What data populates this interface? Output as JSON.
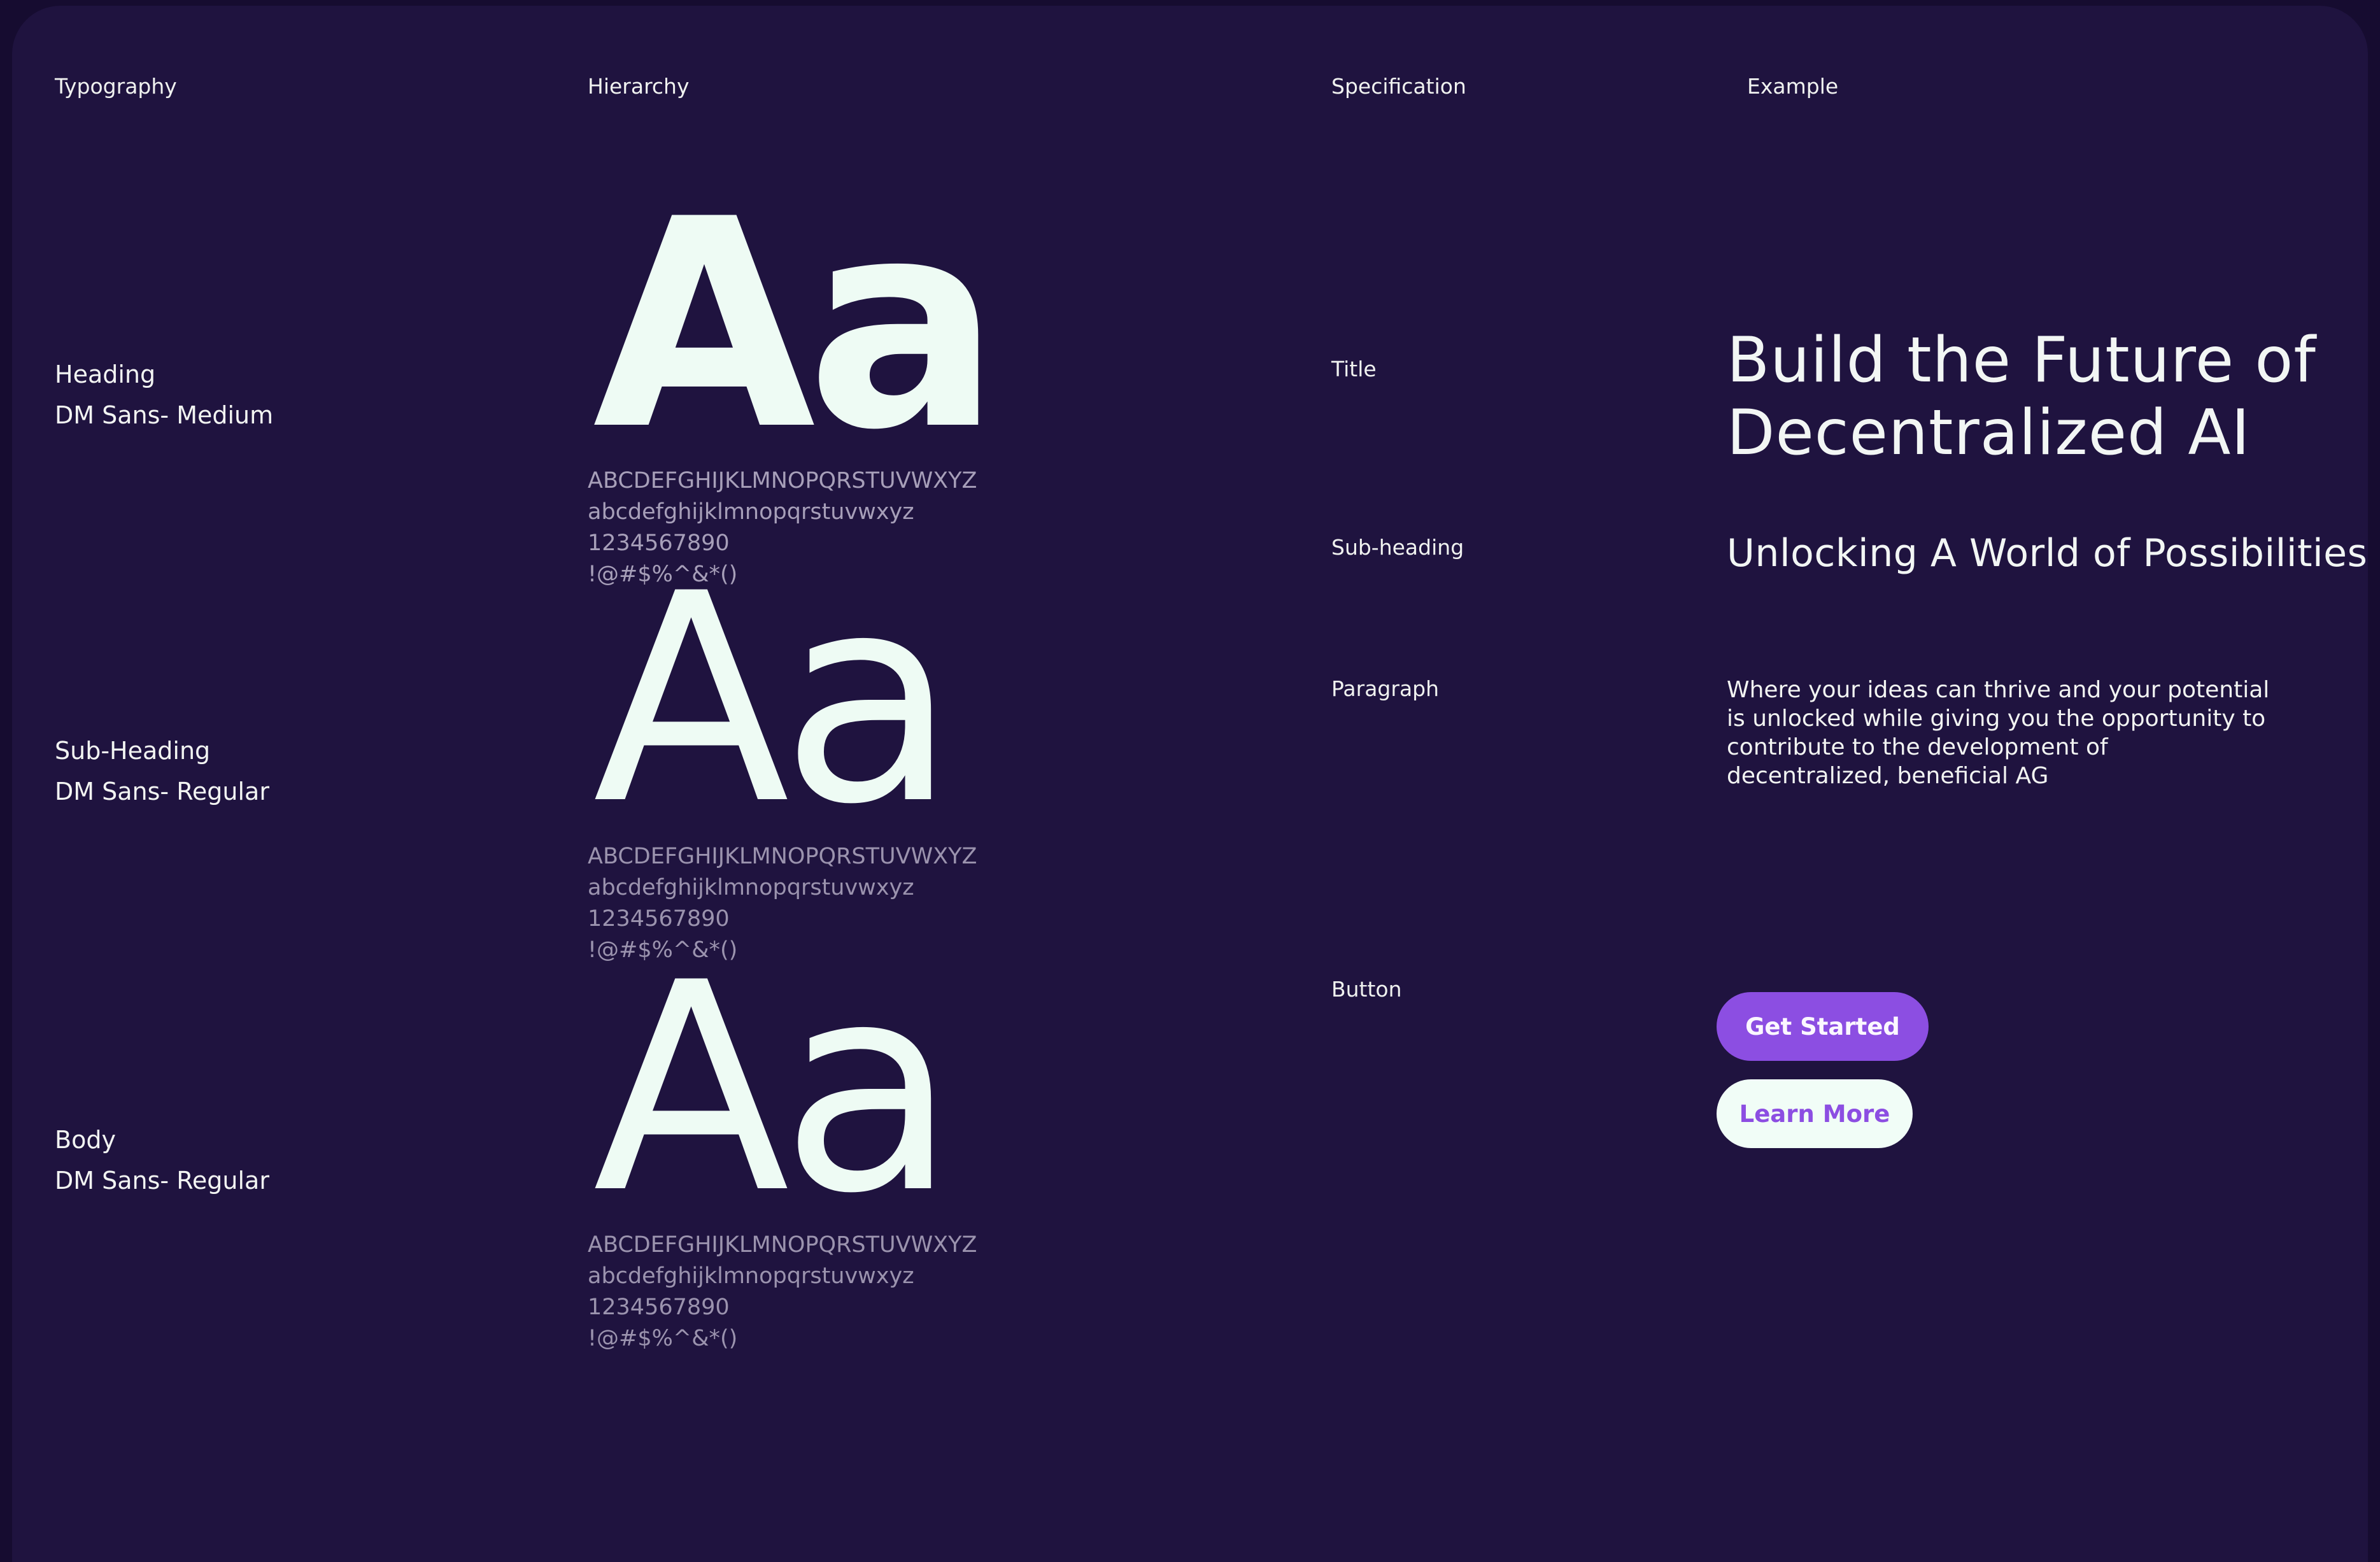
{
  "headers": {
    "typography": "Typography",
    "hierarchy": "Hierarchy",
    "specification": "Specification",
    "example": "Example"
  },
  "styles": [
    {
      "name": "Heading",
      "font": "DM Sans- Medium",
      "sample": "Aa",
      "uppercase": "ABCDEFGHIJKLMNOPQRSTUVWXYZ",
      "lowercase": "abcdefghijklmnopqrstuvwxyz",
      "digits": "1234567890",
      "symbols": "!@#$%^&*()"
    },
    {
      "name": "Sub-Heading",
      "font": "DM Sans- Regular",
      "sample": "Aa",
      "uppercase": "ABCDEFGHIJKLMNOPQRSTUVWXYZ",
      "lowercase": "abcdefghijklmnopqrstuvwxyz",
      "digits": "1234567890",
      "symbols": "!@#$%^&*()"
    },
    {
      "name": "Body",
      "font": "DM Sans- Regular",
      "sample": "Aa",
      "uppercase": "ABCDEFGHIJKLMNOPQRSTUVWXYZ",
      "lowercase": "abcdefghijklmnopqrstuvwxyz",
      "digits": "1234567890",
      "symbols": "!@#$%^&*()"
    }
  ],
  "specs": {
    "title": "Title",
    "subheading": "Sub-heading",
    "paragraph": "Paragraph",
    "button": "Button"
  },
  "examples": {
    "title_line1": "Build the Future of",
    "title_line2": "Decentralized AI",
    "subheading": "Unlocking A World of Possibilities",
    "paragraph_lines": [
      "Where your ideas can thrive and your potential",
      "is unlocked while giving you the opportunity to",
      "contribute to the development of",
      "decentralized, beneficial AG"
    ],
    "primary_button": "Get Started",
    "secondary_button": "Learn More"
  },
  "colors": {
    "background": "#1f133f",
    "outer": "#160c30",
    "text": "#f2f4f2",
    "muted": "#9b93ae",
    "accent": "#8c4ee2",
    "button_light": "#f1fdf7"
  }
}
